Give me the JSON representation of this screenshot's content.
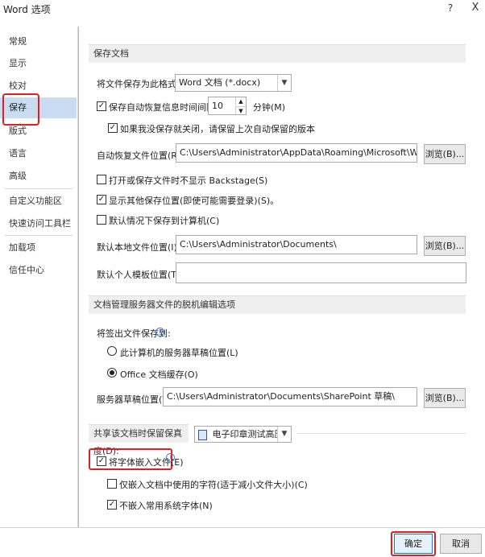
{
  "window": {
    "title": "Word 选项",
    "help": "?",
    "close": "X"
  },
  "sidebar": {
    "items": [
      {
        "label": "常规"
      },
      {
        "label": "显示"
      },
      {
        "label": "校对"
      },
      {
        "label": "保存"
      },
      {
        "label": "版式"
      },
      {
        "label": "语言"
      },
      {
        "label": "高级"
      },
      {
        "label": "自定义功能区"
      },
      {
        "label": "快速访问工具栏"
      },
      {
        "label": "加载项"
      },
      {
        "label": "信任中心"
      }
    ],
    "active": "保存"
  },
  "save_docs": {
    "header": "保存文档",
    "format_label": "将文件保存为此格式(F):",
    "format_value": "Word 文档 (*.docx)",
    "autorecover_label": "保存自动恢复信息时间间隔(A)",
    "autorecover_checked": true,
    "autorecover_minutes": "10",
    "minutes_unit": "分钟(M)",
    "keep_last_label": "如果我没保存就关闭，请保留上次自动保留的版本",
    "keep_last_checked": true,
    "autorecover_location_label": "自动恢复文件位置(R):",
    "autorecover_location": "C:\\Users\\Administrator\\AppData\\Roaming\\Microsoft\\Word\\",
    "browse1": "浏览(B)...",
    "backstage_label": "打开或保存文件时不显示 Backstage(S)",
    "backstage_checked": false,
    "show_other_label": "显示其他保存位置(即使可能需要登录)(S)。",
    "show_other_checked": true,
    "default_computer_label": "默认情况下保存到计算机(C)",
    "default_computer_checked": false,
    "default_local_label": "默认本地文件位置(I):",
    "default_local": "C:\\Users\\Administrator\\Documents\\",
    "browse2": "浏览(B)...",
    "template_label": "默认个人模板位置(T):",
    "template_value": ""
  },
  "offline": {
    "header": "文档管理服务器文件的脱机编辑选项",
    "save_to_label": "将签出文件保存到:",
    "info_icon": "i",
    "option1": "此计算机的服务器草稿位置(L)",
    "option2": "Office 文档缓存(O)",
    "selected": "option2",
    "drafts_label": "服务器草稿位置(V):",
    "drafts_value": "C:\\Users\\Administrator\\Documents\\SharePoint 草稿\\",
    "browse3": "浏览(B)..."
  },
  "fidelity": {
    "header": "共享该文档时保留保真度(D):",
    "doc_name": "电子印章测试高压.doc",
    "embed_label": "将字体嵌入文件(E)",
    "embed_checked": true,
    "embed_info_icon": "i",
    "subset_label": "仅嵌入文档中使用的字符(适于减小文件大小)(C)",
    "subset_checked": false,
    "no_system_label": "不嵌入常用系统字体(N)",
    "no_system_checked": true
  },
  "footer": {
    "ok": "确定",
    "cancel": "取消"
  },
  "colors": {
    "accent": "#1a73e8",
    "highlight_red": "#e02020",
    "active_nav": "#c9dcf2"
  }
}
